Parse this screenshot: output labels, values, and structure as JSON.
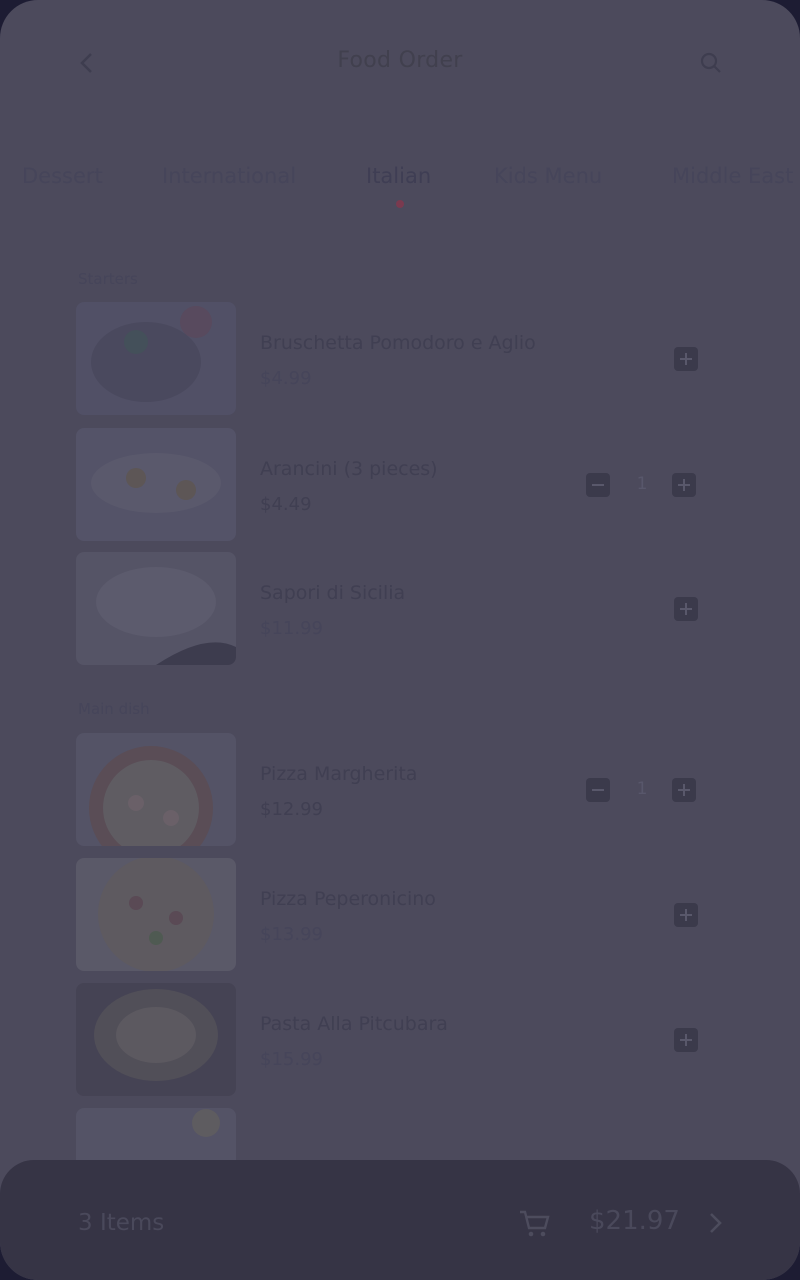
{
  "header": {
    "title": "Food Order",
    "back_icon": "chevron-left-icon",
    "search_icon": "search-icon"
  },
  "tabs": [
    {
      "label": "Dessert"
    },
    {
      "label": "International"
    },
    {
      "label": "Italian",
      "active": true
    },
    {
      "label": "Kids Menu"
    },
    {
      "label": "Middle East"
    }
  ],
  "sections": [
    {
      "title": "Starters",
      "items": [
        {
          "name": "Bruschetta Pomodoro e Aglio",
          "price": "$4.99",
          "qty": 0
        },
        {
          "name": "Arancini (3 pieces)",
          "price": "$4.49",
          "qty": 1
        },
        {
          "name": "Sapori di Sicilia",
          "price": "$11.99",
          "qty": 0
        }
      ]
    },
    {
      "title": "Main dish",
      "items": [
        {
          "name": "Pizza Margherita",
          "price": "$12.99",
          "qty": 1
        },
        {
          "name": "Pizza Peperonicino",
          "price": "$13.99",
          "qty": 0
        },
        {
          "name": "Pasta Alla Pitcubara",
          "price": "$15.99",
          "qty": 0
        }
      ]
    }
  ],
  "cart": {
    "items_label": "3 Items",
    "total": "$21.97",
    "cart_icon": "cart-icon",
    "next_icon": "chevron-right-icon"
  },
  "colors": {
    "overlay": "#4c4a5c",
    "bottom_bar": "#363445",
    "accent_dot": "#7a3a4f"
  }
}
